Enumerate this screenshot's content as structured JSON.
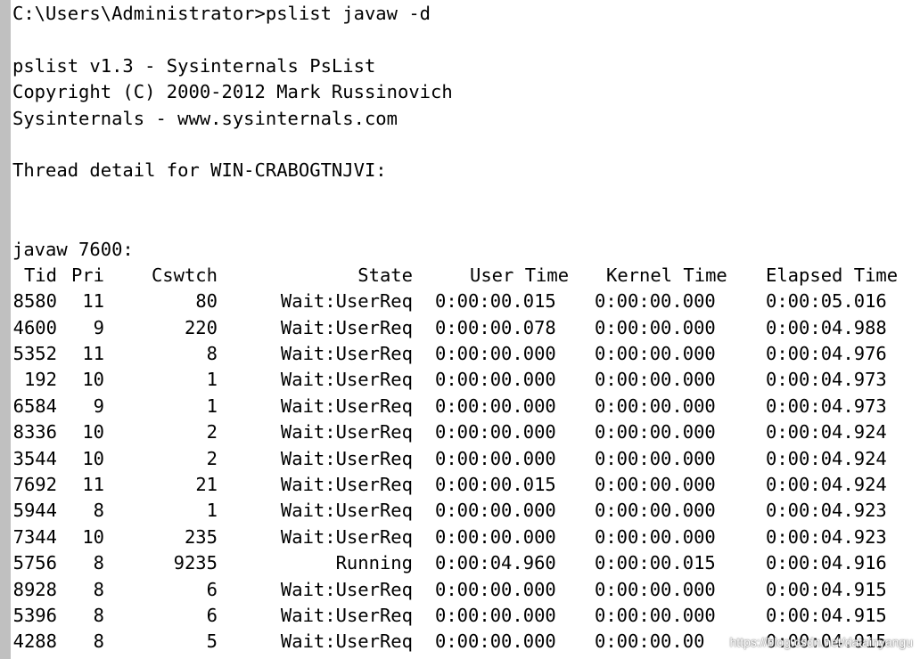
{
  "console": {
    "command_line": "C:\\Users\\Administrator>pslist javaw -d",
    "banner": [
      "pslist v1.3 - Sysinternals PsList",
      "Copyright (C) 2000-2012 Mark Russinovich",
      "Sysinternals - www.sysinternals.com"
    ],
    "thread_detail_heading": "Thread detail for WIN-CRABOGTNJVI:",
    "process_heading": "javaw 7600:",
    "columns": {
      "tid": "Tid",
      "pri": "Pri",
      "cswtch": "Cswtch",
      "state": "State",
      "user_time": "User Time",
      "kernel_time": "Kernel Time",
      "elapsed_time": "Elapsed Time"
    },
    "threads": [
      {
        "tid": "8580",
        "pri": "11",
        "cswtch": "80",
        "state": "Wait:UserReq",
        "user_time": "0:00:00.015",
        "kernel_time": "0:00:00.000",
        "elapsed_time": "0:00:05.016"
      },
      {
        "tid": "4600",
        "pri": "9",
        "cswtch": "220",
        "state": "Wait:UserReq",
        "user_time": "0:00:00.078",
        "kernel_time": "0:00:00.000",
        "elapsed_time": "0:00:04.988"
      },
      {
        "tid": "5352",
        "pri": "11",
        "cswtch": "8",
        "state": "Wait:UserReq",
        "user_time": "0:00:00.000",
        "kernel_time": "0:00:00.000",
        "elapsed_time": "0:00:04.976"
      },
      {
        "tid": "192",
        "pri": "10",
        "cswtch": "1",
        "state": "Wait:UserReq",
        "user_time": "0:00:00.000",
        "kernel_time": "0:00:00.000",
        "elapsed_time": "0:00:04.973"
      },
      {
        "tid": "6584",
        "pri": "9",
        "cswtch": "1",
        "state": "Wait:UserReq",
        "user_time": "0:00:00.000",
        "kernel_time": "0:00:00.000",
        "elapsed_time": "0:00:04.973"
      },
      {
        "tid": "8336",
        "pri": "10",
        "cswtch": "2",
        "state": "Wait:UserReq",
        "user_time": "0:00:00.000",
        "kernel_time": "0:00:00.000",
        "elapsed_time": "0:00:04.924"
      },
      {
        "tid": "3544",
        "pri": "10",
        "cswtch": "2",
        "state": "Wait:UserReq",
        "user_time": "0:00:00.000",
        "kernel_time": "0:00:00.000",
        "elapsed_time": "0:00:04.924"
      },
      {
        "tid": "7692",
        "pri": "11",
        "cswtch": "21",
        "state": "Wait:UserReq",
        "user_time": "0:00:00.015",
        "kernel_time": "0:00:00.000",
        "elapsed_time": "0:00:04.924"
      },
      {
        "tid": "5944",
        "pri": "8",
        "cswtch": "1",
        "state": "Wait:UserReq",
        "user_time": "0:00:00.000",
        "kernel_time": "0:00:00.000",
        "elapsed_time": "0:00:04.923"
      },
      {
        "tid": "7344",
        "pri": "10",
        "cswtch": "235",
        "state": "Wait:UserReq",
        "user_time": "0:00:00.000",
        "kernel_time": "0:00:00.000",
        "elapsed_time": "0:00:04.923"
      },
      {
        "tid": "5756",
        "pri": "8",
        "cswtch": "9235",
        "state": "Running",
        "user_time": "0:00:04.960",
        "kernel_time": "0:00:00.015",
        "elapsed_time": "0:00:04.916"
      },
      {
        "tid": "8928",
        "pri": "8",
        "cswtch": "6",
        "state": "Wait:UserReq",
        "user_time": "0:00:00.000",
        "kernel_time": "0:00:00.000",
        "elapsed_time": "0:00:04.915"
      },
      {
        "tid": "5396",
        "pri": "8",
        "cswtch": "6",
        "state": "Wait:UserReq",
        "user_time": "0:00:00.000",
        "kernel_time": "0:00:00.000",
        "elapsed_time": "0:00:04.915"
      },
      {
        "tid": "4288",
        "pri": "8",
        "cswtch": "5",
        "state": "Wait:UserReq",
        "user_time": "0:00:00.000",
        "kernel_time": "0:00:00.00",
        "elapsed_time": "0:00:04.915"
      }
    ]
  },
  "watermark": "https://blog.csdn.net/datainyangu",
  "colors": {
    "background": "#ffffff",
    "text": "#000000",
    "left_border": "#c0c0c0"
  }
}
